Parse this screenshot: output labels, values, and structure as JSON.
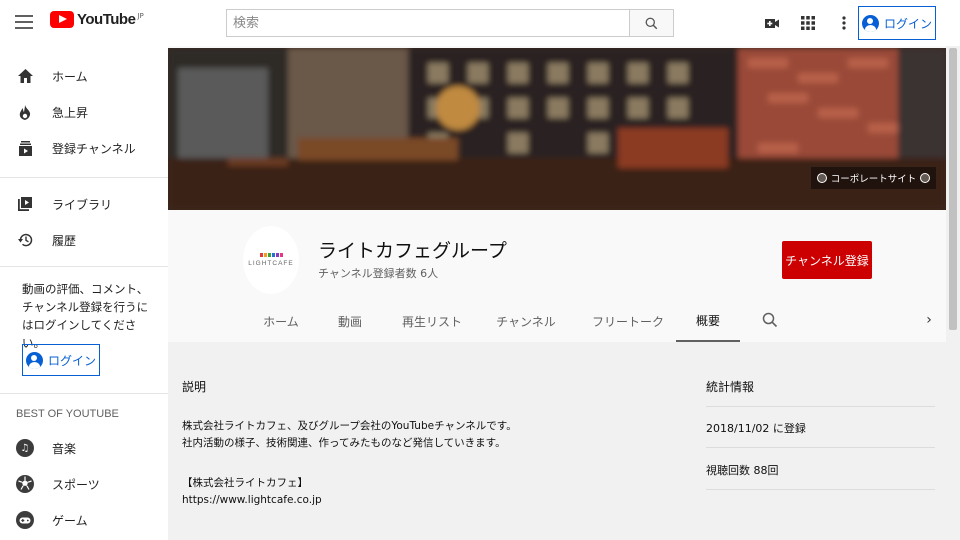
{
  "header": {
    "logo_text": "YouTube",
    "logo_region": "JP",
    "search_placeholder": "検索",
    "login_label": "ログイン"
  },
  "sidebar": {
    "items": [
      {
        "label": "ホーム",
        "icon": "home-icon"
      },
      {
        "label": "急上昇",
        "icon": "flame-icon"
      },
      {
        "label": "登録チャンネル",
        "icon": "subscriptions-icon"
      },
      {
        "label": "ライブラリ",
        "icon": "library-icon"
      },
      {
        "label": "履歴",
        "icon": "history-icon"
      }
    ],
    "note": "動画の評価、コメント、チャンネル登録を行うにはログインしてください。",
    "login_label": "ログイン",
    "best_title": "BEST OF YOUTUBE",
    "best_items": [
      {
        "label": "音楽",
        "icon": "music-icon"
      },
      {
        "label": "スポーツ",
        "icon": "sports-icon"
      },
      {
        "label": "ゲーム",
        "icon": "gaming-icon"
      }
    ]
  },
  "banner": {
    "corp_link": "コーポレートサイト"
  },
  "channel": {
    "name": "ライトカフェグループ",
    "subscribers": "チャンネル登録者数 6人",
    "avatar_text": "LIGHTCAFE",
    "subscribe_label": "チャンネル登録",
    "tabs": [
      "ホーム",
      "動画",
      "再生リスト",
      "チャンネル",
      "フリートーク",
      "概要"
    ],
    "active_tab": "概要"
  },
  "about": {
    "description_title": "説明",
    "description_lines": [
      "株式会社ライトカフェ、及びグループ会社のYouTubeチャンネルです。",
      "社内活動の様子、技術関連、作ってみたものなど発信していきます。",
      "",
      "【株式会社ライトカフェ】",
      "https://www.lightcafe.co.jp"
    ],
    "stats_title": "統計情報",
    "joined": "2018/11/02 に登録",
    "views": "視聴回数 88回"
  },
  "colors": {
    "brand_red": "#ff0000",
    "subscribe_red": "#cc0000",
    "link_blue": "#065fd4"
  }
}
